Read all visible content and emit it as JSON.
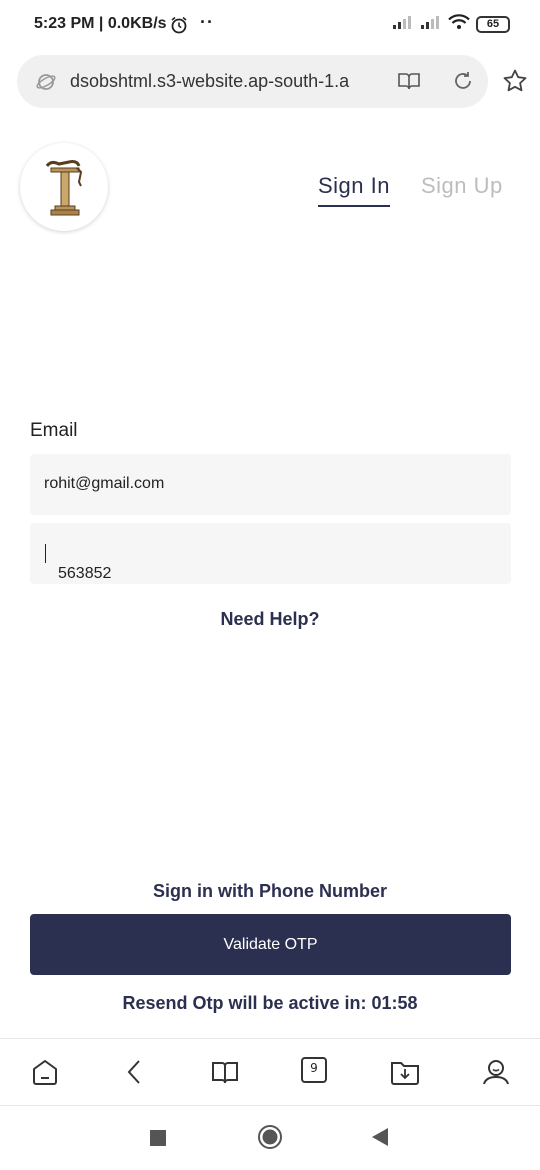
{
  "status_bar": {
    "time_text": "5:23 PM | 0.0KB/s",
    "battery": "65"
  },
  "browser": {
    "url": "dsobshtml.s3-website.ap-south-1.a"
  },
  "header": {
    "tabs": [
      {
        "label": "Sign In",
        "active": true
      },
      {
        "label": "Sign Up",
        "active": false
      }
    ]
  },
  "form": {
    "email_label": "Email",
    "email_value": "rohit@gmail.com",
    "otp_value": "563852",
    "need_help": "Need Help?",
    "phone_signin": "Sign in with Phone Number",
    "validate_label": "Validate OTP",
    "resend_text": "Resend Otp will be active in: 01:58"
  },
  "bottom_nav": {
    "tab_count": "9",
    "icons": [
      "home-icon",
      "back-icon",
      "bookmarks-icon",
      "tabs-icon",
      "downloads-icon",
      "profile-icon"
    ]
  },
  "colors": {
    "primary": "#2b3050",
    "inactive_tab": "#bdbdbd",
    "field_bg": "#f6f6f6"
  }
}
